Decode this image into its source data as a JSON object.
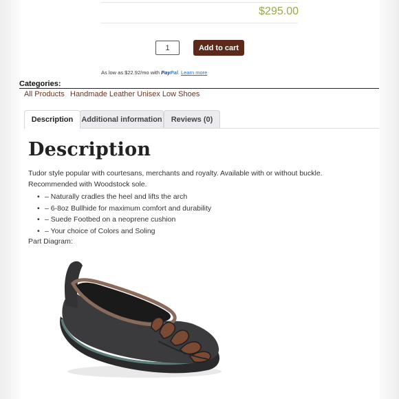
{
  "product": {
    "price": "$295.00",
    "quantity": "1",
    "add_to_cart_label": "Add to cart"
  },
  "paypal": {
    "prefix": "As low as $22.92/mo with",
    "logo_pay": "Pay",
    "logo_pal": "Pal",
    "separator": ".",
    "learn_more": "Learn more"
  },
  "categories": {
    "label": "Categories:",
    "items": [
      "All Products",
      "Handmade Leather Unisex Low Shoes"
    ]
  },
  "tabs": [
    {
      "label": "Description",
      "active": true
    },
    {
      "label": "Additional information",
      "active": false
    },
    {
      "label": "Reviews (0)",
      "active": false
    }
  ],
  "description": {
    "heading": "Description",
    "paragraph": "Tudor style popular with courtesans, merchants and royalty. Available with or without buckle. Recommended with Woodstock sole.",
    "bullets": [
      "– Naturally cradles the heel and lifts the arch",
      "– 6-8oz Bullhide for maximum comfort and durability",
      "– Suede Footbed on a neoprene cushion",
      "– Your choice of Colors and Soling"
    ],
    "part_diagram_label": "Part Diagram:"
  },
  "colors": {
    "price": "#9aa84a",
    "button_bg": "#5b2a1b",
    "category_link": "#6b3322",
    "learn_more": "#2b6cd8"
  }
}
